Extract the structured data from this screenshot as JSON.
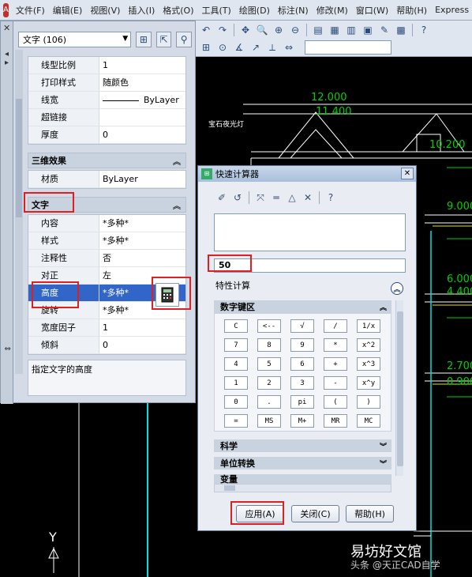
{
  "menu": {
    "items": [
      "文件(F)",
      "编辑(E)",
      "视图(V)",
      "插入(I)",
      "格式(O)",
      "工具(T)",
      "绘图(D)",
      "标注(N)",
      "修改(M)",
      "窗口(W)",
      "帮助(H)",
      "Express"
    ]
  },
  "palette": {
    "selection": "文字 (106)",
    "rows_general": [
      {
        "name": "线型比例",
        "value": "1"
      },
      {
        "name": "打印样式",
        "value": "随颜色"
      },
      {
        "name": "线宽",
        "value": "ByLayer"
      },
      {
        "name": "超链接",
        "value": ""
      },
      {
        "name": "厚度",
        "value": "0"
      }
    ],
    "section_3d": "三维效果",
    "rows_3d": [
      {
        "name": "材质",
        "value": "ByLayer"
      }
    ],
    "section_text": "文字",
    "rows_text": [
      {
        "name": "内容",
        "value": "*多种*"
      },
      {
        "name": "样式",
        "value": "*多种*"
      },
      {
        "name": "注释性",
        "value": "否"
      },
      {
        "name": "对正",
        "value": "左"
      },
      {
        "name": "高度",
        "value": "*多种*"
      },
      {
        "name": "旋转",
        "value": "*多种*"
      },
      {
        "name": "宽度因子",
        "value": "1"
      },
      {
        "name": "倾斜",
        "value": "0"
      }
    ],
    "description": "指定文字的高度"
  },
  "calculator": {
    "title": "快速计算器",
    "input_value": "50",
    "property_calc_label": "特性计算",
    "numpad_title": "数字键区",
    "keys": [
      [
        "C",
        "<--",
        "√",
        "/",
        "1/x"
      ],
      [
        "7",
        "8",
        "9",
        "*",
        "x^2"
      ],
      [
        "4",
        "5",
        "6",
        "+",
        "x^3"
      ],
      [
        "1",
        "2",
        "3",
        "-",
        "x^y"
      ],
      [
        "0",
        ".",
        "pi",
        "(",
        ")"
      ],
      [
        "=",
        "MS",
        "M+",
        "MR",
        "MC"
      ]
    ],
    "sections": [
      "科学",
      "单位转换",
      "变量"
    ],
    "buttons": {
      "apply": "应用(A)",
      "close": "关闭(C)",
      "help": "帮助(H)"
    }
  },
  "drawing": {
    "dimensions": [
      "12.000",
      "11.400",
      "10.200",
      "9.000",
      "6.000",
      "4.400",
      "2.700",
      "0.900"
    ],
    "note": "宝石夜光灯",
    "axis_y": "Y"
  },
  "watermark": {
    "main": "易坊好文馆",
    "sub": "头条 @天正CAD自学"
  },
  "colors": {
    "selection": "#3166c8",
    "highlight_red": "#e02020",
    "cad_white": "#ffffff",
    "cad_yellow": "#e8e800",
    "cad_cyan": "#00e0e0",
    "cad_green": "#00d000"
  }
}
